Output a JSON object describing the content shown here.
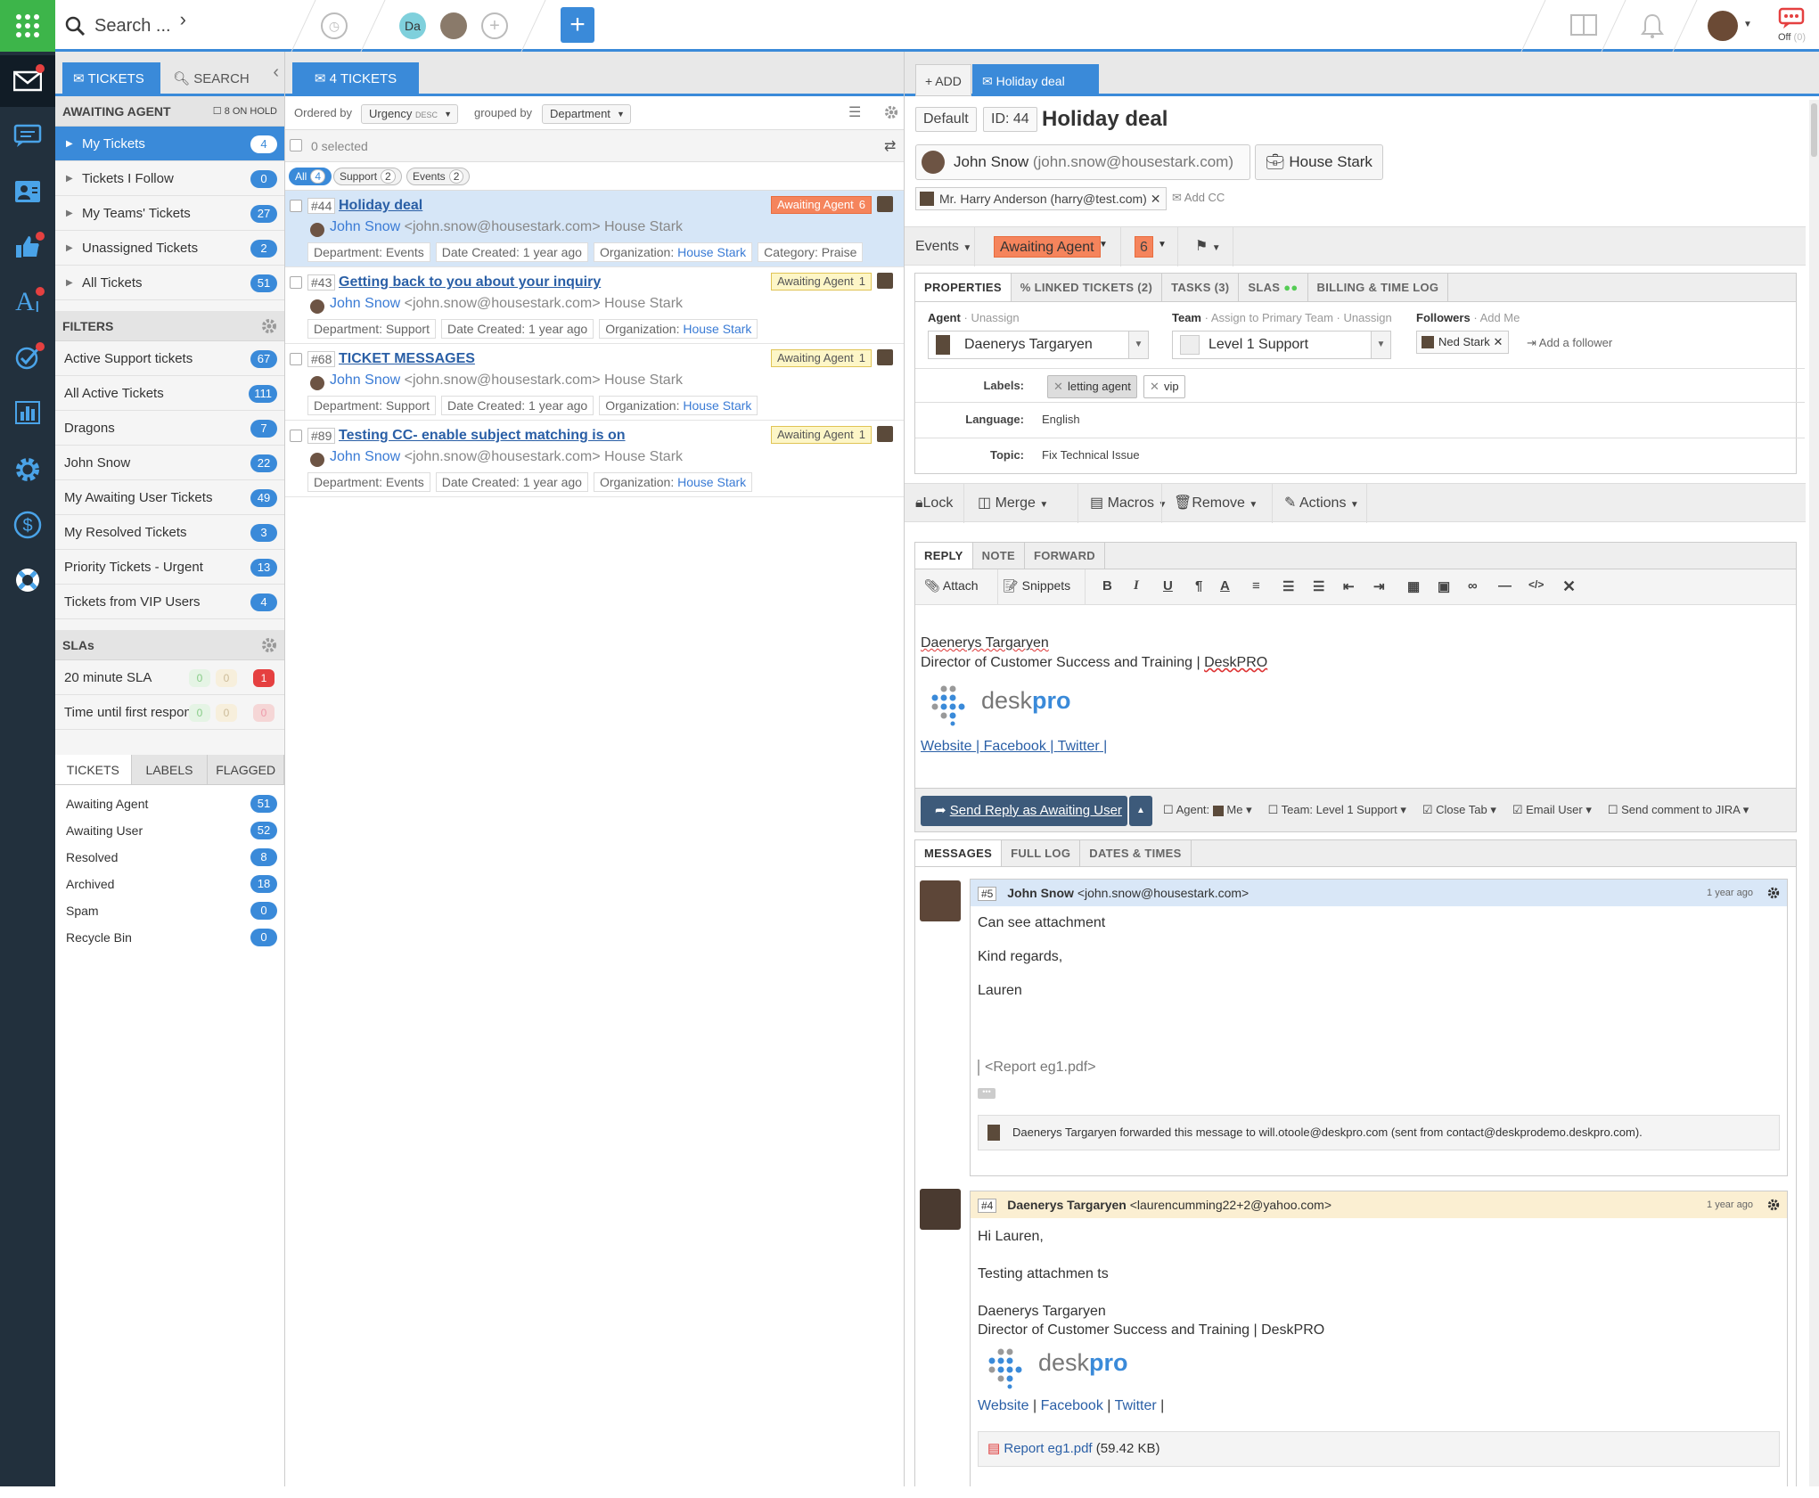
{
  "topbar": {
    "search_placeholder": "Search ...",
    "avatar_initials": "Da",
    "chat_status": "Off",
    "chat_count": "(0)"
  },
  "sidebar": {
    "tabs": [
      "TICKETS",
      "SEARCH"
    ],
    "awaiting_heading": "AWAITING AGENT",
    "on_hold": "8 ON HOLD",
    "my_items": [
      {
        "label": "My Tickets",
        "count": "4"
      },
      {
        "label": "Tickets I Follow",
        "count": "0"
      },
      {
        "label": "My Teams' Tickets",
        "count": "27"
      },
      {
        "label": "Unassigned Tickets",
        "count": "2"
      },
      {
        "label": "All Tickets",
        "count": "51"
      }
    ],
    "filters_heading": "FILTERS",
    "filters": [
      {
        "label": "Active Support tickets",
        "count": "67"
      },
      {
        "label": "All Active Tickets",
        "count": "111"
      },
      {
        "label": "Dragons",
        "count": "7"
      },
      {
        "label": "John Snow",
        "count": "22"
      },
      {
        "label": "My Awaiting User Tickets",
        "count": "49"
      },
      {
        "label": "My Resolved Tickets",
        "count": "3"
      },
      {
        "label": "Priority Tickets - Urgent",
        "count": "13"
      },
      {
        "label": "Tickets from VIP Users",
        "count": "4"
      }
    ],
    "slas_heading": "SLAs",
    "slas": [
      {
        "label": "20 minute SLA",
        "a": "0",
        "b": "0",
        "c": "1"
      },
      {
        "label": "Time until first respon:",
        "a": "0",
        "b": "0",
        "c": "0"
      }
    ],
    "bottom_tabs": [
      "TICKETS",
      "LABELS",
      "FLAGGED"
    ],
    "statuses": [
      {
        "label": "Awaiting Agent",
        "count": "51"
      },
      {
        "label": "Awaiting User",
        "count": "52"
      },
      {
        "label": "Resolved",
        "count": "8"
      },
      {
        "label": "Archived",
        "count": "18"
      },
      {
        "label": "Spam",
        "count": "0"
      },
      {
        "label": "Recycle Bin",
        "count": "0"
      }
    ]
  },
  "list": {
    "tab_label": "4 TICKETS",
    "ordered_by_label": "Ordered by",
    "ordered_by_value": "Urgency",
    "ordered_dir": "DESC",
    "grouped_by_label": "grouped by",
    "grouped_by_value": "Department",
    "selected_text": "0 selected",
    "filters": [
      {
        "label": "All",
        "count": "4"
      },
      {
        "label": "Support",
        "count": "2"
      },
      {
        "label": "Events",
        "count": "2"
      }
    ],
    "tickets": [
      {
        "id": "#44",
        "title": "Holiday deal",
        "user": "John Snow",
        "email": "<john.snow@housestark.com> House Stark",
        "department": "Department: Events",
        "created": "Date Created: 1 year ago",
        "org_label": "Organization:",
        "org": "House Stark",
        "category": "Category: Praise",
        "status": "Awaiting Agent",
        "urgency": "6"
      },
      {
        "id": "#43",
        "title": "Getting back to you about your inquiry",
        "user": "John Snow",
        "email": "<john.snow@housestark.com> House Stark",
        "department": "Department: Support",
        "created": "Date Created: 1 year ago",
        "org_label": "Organization:",
        "org": "House Stark",
        "status": "Awaiting Agent",
        "urgency": "1"
      },
      {
        "id": "#68",
        "title": "TICKET MESSAGES",
        "user": "John Snow",
        "email": "<john.snow@housestark.com> House Stark",
        "department": "Department: Support",
        "created": "Date Created: 1 year ago",
        "org_label": "Organization:",
        "org": "House Stark",
        "status": "Awaiting Agent",
        "urgency": "1"
      },
      {
        "id": "#89",
        "title": "Testing CC- enable subject matching is on",
        "user": "John Snow",
        "email": "<john.snow@housestark.com> House Stark",
        "department": "Department: Events",
        "created": "Date Created: 1 year ago",
        "org_label": "Organization:",
        "org": "House Stark",
        "status": "Awaiting Agent",
        "urgency": "1"
      }
    ]
  },
  "detail": {
    "add_tab": "ADD",
    "active_tab": "Holiday deal",
    "layout": "Default",
    "id_label": "ID: 44",
    "title": "Holiday deal",
    "requester": "John Snow",
    "requester_email": "(john.snow@housestark.com)",
    "organization": "House Stark",
    "cc": "Mr. Harry Anderson (harry@test.com)",
    "add_cc": "Add CC",
    "department": "Events",
    "status": "Awaiting Agent",
    "urgency": "6",
    "prop_tabs": [
      "PROPERTIES",
      "LINKED TICKETS (2)",
      "TASKS (3)",
      "SLAS",
      "BILLING & TIME LOG"
    ],
    "agent_label": "Agent",
    "agent_unassign": "Unassign",
    "agent_value": "Daenerys Targaryen",
    "team_label": "Team",
    "team_assign": "Assign to Primary Team",
    "team_unassign": "Unassign",
    "team_value": "Level 1 Support",
    "followers_label": "Followers",
    "followers_addme": "Add Me",
    "follower": "Ned Stark",
    "add_follower": "Add a follower",
    "labels_label": "Labels:",
    "labels": [
      "letting agent",
      "vip"
    ],
    "language_label": "Language:",
    "language": "English",
    "topic_label": "Topic:",
    "topic": "Fix Technical Issue",
    "actions": [
      "Lock",
      "Merge",
      "Macros",
      "Remove",
      "Actions"
    ],
    "reply_tabs": [
      "REPLY",
      "NOTE",
      "FORWARD"
    ],
    "attach": "Attach",
    "snippets": "Snippets",
    "sig_name": "Daenerys Targaryen",
    "sig_title": "Director of Customer Success and Training | ",
    "sig_company": "DeskPRO",
    "logo_text_a": "desk",
    "logo_text_b": "pro",
    "links": [
      "Website",
      "Facebook",
      "Twitter"
    ],
    "send_button": "Send Reply as Awaiting User",
    "opt_agent": "Agent:",
    "opt_agent_val": "Me",
    "opt_team": "Team: Level 1 Support",
    "opt_close": "Close Tab",
    "opt_email": "Email User",
    "opt_jira": "Send comment to JIRA",
    "msg_tabs": [
      "MESSAGES",
      "FULL LOG",
      "DATES & TIMES"
    ],
    "messages": [
      {
        "num": "#5",
        "author": "John Snow",
        "email": "<john.snow@housestark.com>",
        "time": "1 year ago",
        "lines": [
          "Can see attachment",
          "Kind regards,",
          "Lauren"
        ],
        "attachment": "<Report eg1.pdf>",
        "forward_note": "Daenerys Targaryen forwarded this message to will.otoole@deskpro.com (sent from contact@deskprodemo.deskpro.com)."
      },
      {
        "num": "#4",
        "author": "Daenerys Targaryen",
        "email": "<laurencumming22+2@yahoo.com>",
        "time": "1 year ago",
        "lines": [
          "Hi Lauren,",
          "Testing attachmen ts",
          "Daenerys Targaryen",
          "Director of Customer Success and Training | DeskPRO"
        ],
        "file": "Report eg1.pdf",
        "file_size": "(59.42 KB)"
      }
    ]
  },
  "colors": {
    "brand_green": "#3db54a",
    "accent_blue": "#3a8ad9",
    "nav_dark": "#22303d",
    "status_hot": "#f5845c"
  }
}
